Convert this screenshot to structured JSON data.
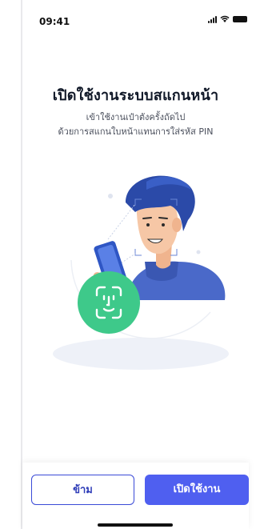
{
  "status_bar": {
    "time": "09:41"
  },
  "header": {
    "title": "เปิดใช้งานระบบสแกนหน้า",
    "subtitle_line1": "เข้าใช้งานเป๋าตังครั้งถัดไป",
    "subtitle_line2": "ด้วยการสแกนใบหน้าแทนการใส่รหัส PIN"
  },
  "illustration": {
    "icon": "face-scan-illustration",
    "badge_icon": "face-id-icon"
  },
  "actions": {
    "skip_label": "ข้าม",
    "enable_label": "เปิดใช้งาน"
  },
  "colors": {
    "primary": "#4f5ff0",
    "accent_green": "#3ec98a",
    "hair": "#2b4aa8",
    "skin": "#f6c7a6"
  }
}
